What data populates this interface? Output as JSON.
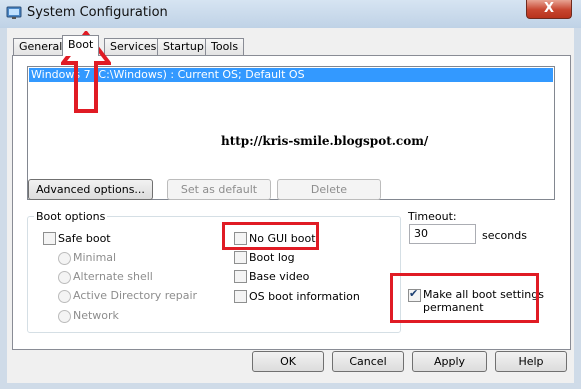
{
  "window": {
    "title": "System Configuration",
    "close_glyph": "X"
  },
  "tabs": [
    {
      "label": "General",
      "active": false
    },
    {
      "label": "Boot",
      "active": true
    },
    {
      "label": "Services",
      "active": false
    },
    {
      "label": "Startup",
      "active": false
    },
    {
      "label": "Tools",
      "active": false
    }
  ],
  "boot_list": {
    "selected_entry": "Windows 7 (C:\\Windows) : Current OS; Default OS"
  },
  "watermark": "http://kris-smile.blogspot.com/",
  "list_buttons": {
    "advanced": "Advanced options...",
    "set_default": "Set as default",
    "delete": "Delete"
  },
  "boot_options": {
    "group_label": "Boot options",
    "safe_boot": {
      "label": "Safe boot",
      "checked": false
    },
    "radios": [
      "Minimal",
      "Alternate shell",
      "Active Directory repair",
      "Network"
    ],
    "no_gui_boot": {
      "label": "No GUI boot",
      "checked": false
    },
    "boot_log": {
      "label": "Boot log",
      "checked": false
    },
    "base_video": {
      "label": "Base video",
      "checked": false
    },
    "os_boot_info": {
      "label": "OS boot information",
      "checked": false
    }
  },
  "timeout": {
    "label": "Timeout:",
    "value": "30",
    "unit": "seconds"
  },
  "make_permanent": {
    "label_line1": "Make all boot settings",
    "label_line2": "permanent",
    "checked": true
  },
  "footer": {
    "ok": "OK",
    "cancel": "Cancel",
    "apply": "Apply",
    "help": "Help"
  },
  "colors": {
    "annotation_red": "#e01b24",
    "selection_blue": "#3399ff"
  }
}
